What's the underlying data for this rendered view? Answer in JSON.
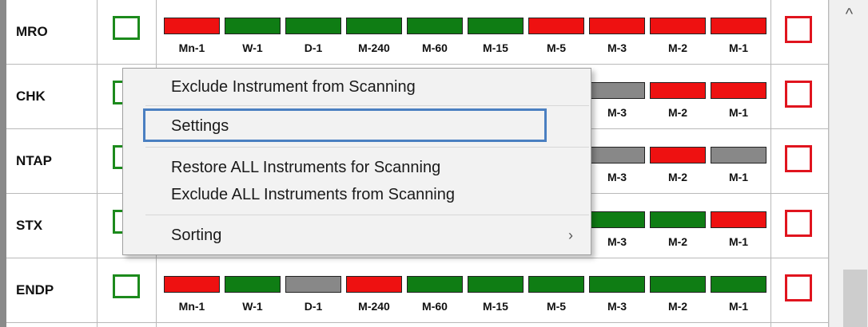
{
  "rows": [
    {
      "symbol": "MRO",
      "bars": [
        {
          "label": "Mn-1",
          "color": "#ee1111"
        },
        {
          "label": "W-1",
          "color": "#0f7d14"
        },
        {
          "label": "D-1",
          "color": "#0f7d14"
        },
        {
          "label": "M-240",
          "color": "#0f7d14"
        },
        {
          "label": "M-60",
          "color": "#0f7d14"
        },
        {
          "label": "M-15",
          "color": "#0f7d14"
        },
        {
          "label": "M-5",
          "color": "#ee1111"
        },
        {
          "label": "M-3",
          "color": "#ee1111"
        },
        {
          "label": "M-2",
          "color": "#ee1111"
        },
        {
          "label": "M-1",
          "color": "#ee1111"
        }
      ]
    },
    {
      "symbol": "CHK",
      "bars": [
        {
          "label": "",
          "color": ""
        },
        {
          "label": "",
          "color": ""
        },
        {
          "label": "",
          "color": ""
        },
        {
          "label": "",
          "color": ""
        },
        {
          "label": "",
          "color": ""
        },
        {
          "label": "",
          "color": ""
        },
        {
          "label": "",
          "color": ""
        },
        {
          "label": "M-3",
          "color": "#888888"
        },
        {
          "label": "M-2",
          "color": "#ee1111"
        },
        {
          "label": "M-1",
          "color": "#ee1111"
        }
      ]
    },
    {
      "symbol": "NTAP",
      "bars": [
        {
          "label": "",
          "color": ""
        },
        {
          "label": "",
          "color": ""
        },
        {
          "label": "",
          "color": ""
        },
        {
          "label": "",
          "color": ""
        },
        {
          "label": "",
          "color": ""
        },
        {
          "label": "",
          "color": ""
        },
        {
          "label": "",
          "color": ""
        },
        {
          "label": "M-3",
          "color": "#888888"
        },
        {
          "label": "M-2",
          "color": "#ee1111"
        },
        {
          "label": "M-1",
          "color": "#888888"
        }
      ]
    },
    {
      "symbol": "STX",
      "bars": [
        {
          "label": "",
          "color": ""
        },
        {
          "label": "",
          "color": ""
        },
        {
          "label": "",
          "color": ""
        },
        {
          "label": "",
          "color": ""
        },
        {
          "label": "",
          "color": ""
        },
        {
          "label": "",
          "color": ""
        },
        {
          "label": "",
          "color": ""
        },
        {
          "label": "M-3",
          "color": "#0f7d14"
        },
        {
          "label": "M-2",
          "color": "#0f7d14"
        },
        {
          "label": "M-1",
          "color": "#ee1111"
        }
      ]
    },
    {
      "symbol": "ENDP",
      "bars": [
        {
          "label": "Mn-1",
          "color": "#ee1111"
        },
        {
          "label": "W-1",
          "color": "#0f7d14"
        },
        {
          "label": "D-1",
          "color": "#888888"
        },
        {
          "label": "M-240",
          "color": "#ee1111"
        },
        {
          "label": "M-60",
          "color": "#0f7d14"
        },
        {
          "label": "M-15",
          "color": "#0f7d14"
        },
        {
          "label": "M-5",
          "color": "#0f7d14"
        },
        {
          "label": "M-3",
          "color": "#0f7d14"
        },
        {
          "label": "M-2",
          "color": "#0f7d14"
        },
        {
          "label": "M-1",
          "color": "#0f7d14"
        }
      ]
    }
  ],
  "context_menu": {
    "items": [
      {
        "label": "Exclude Instrument from Scanning",
        "name": "menu-item-exclude-instrument"
      },
      {
        "label": "Settings",
        "name": "menu-item-settings"
      },
      {
        "label": "Restore ALL Instruments for Scanning",
        "name": "menu-item-restore-all"
      },
      {
        "label": "Exclude ALL Instruments from Scanning",
        "name": "menu-item-exclude-all"
      },
      {
        "label": "Sorting",
        "name": "menu-item-sorting",
        "submenu": true
      }
    ],
    "highlighted": "Settings",
    "submenu_arrow": "›"
  },
  "scrollbar": {
    "up_arrow": "^"
  },
  "colors": {
    "green_box": "#1c8a1c",
    "red_box": "#e0141e",
    "highlight": "#4a7fc1"
  }
}
